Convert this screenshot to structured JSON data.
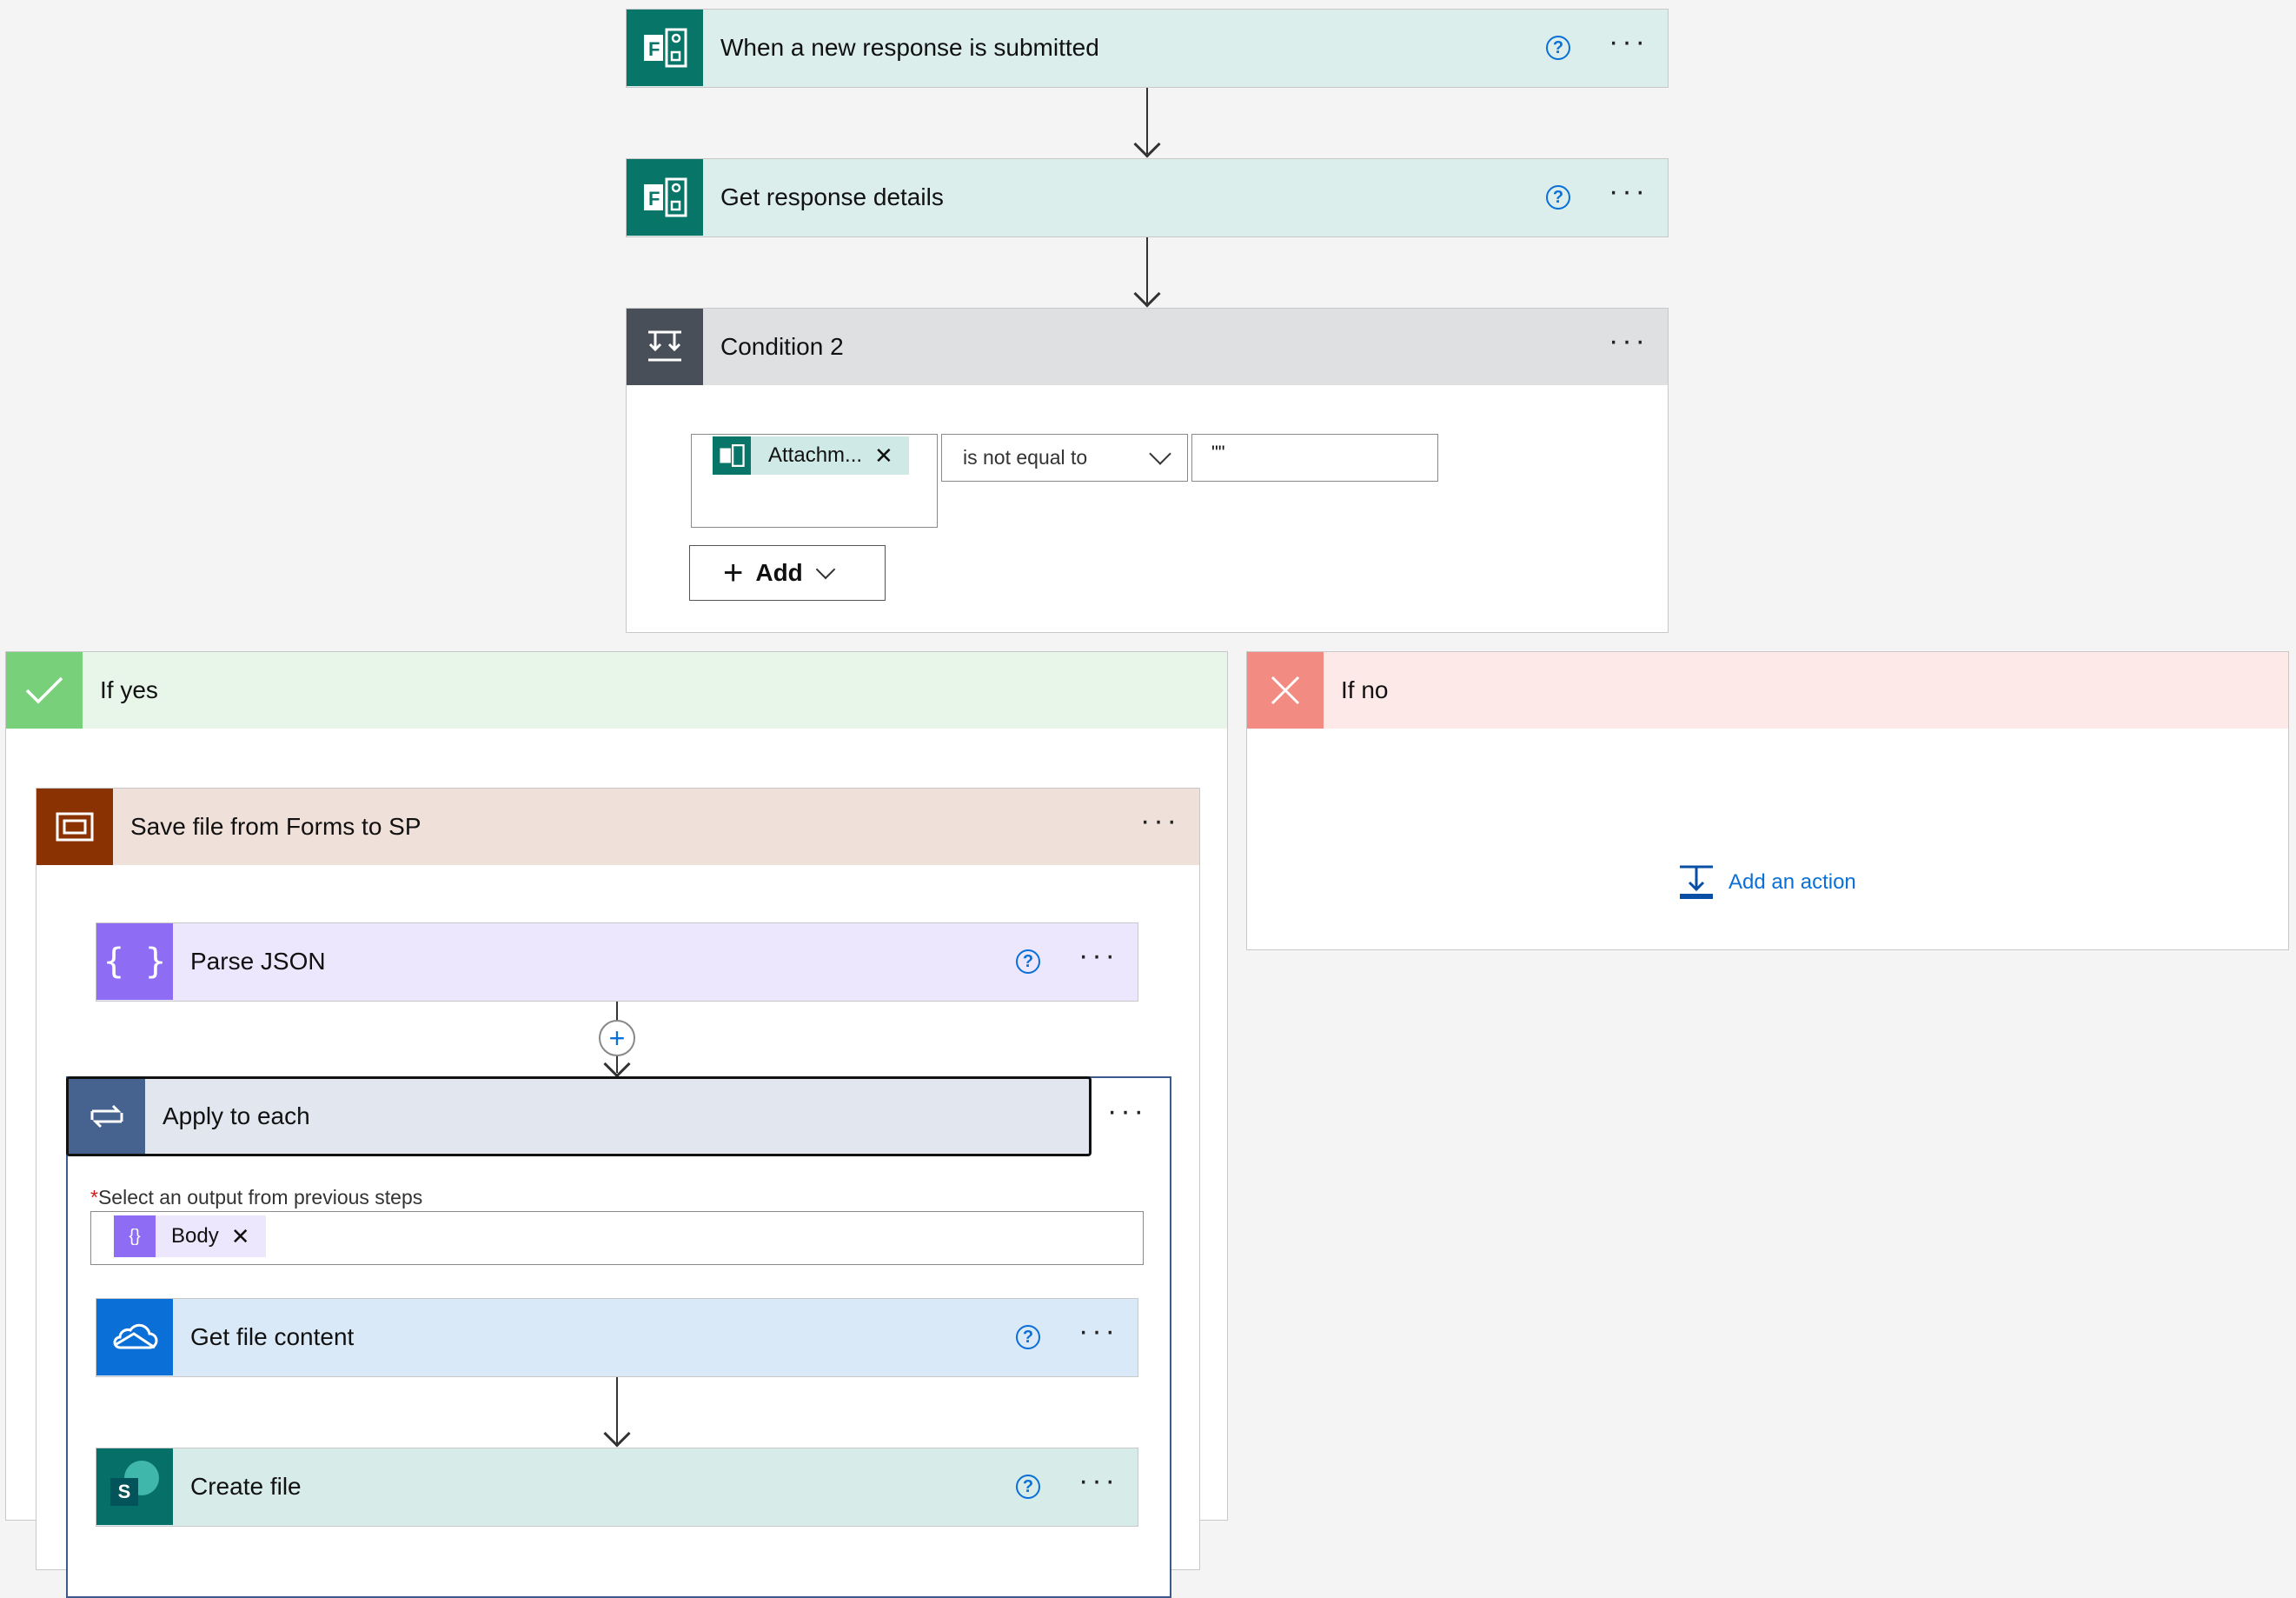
{
  "trigger": {
    "title": "When a new response is submitted",
    "icon": "forms-icon",
    "color": "#077568"
  },
  "get_details": {
    "title": "Get response details",
    "icon": "forms-icon",
    "color": "#077568"
  },
  "condition": {
    "title": "Condition 2",
    "token_label": "Attachm...",
    "operator": "is not equal to",
    "value": "\"\"",
    "add_label": "Add"
  },
  "if_yes": {
    "label": "If yes",
    "color": "#78d17a"
  },
  "if_no": {
    "label": "If no",
    "color": "#f28b82",
    "add_action": "Add an action"
  },
  "scope": {
    "title": "Save file from Forms to SP",
    "color": "#8b3203"
  },
  "parse_json": {
    "title": "Parse JSON",
    "color": "#8e6cf4"
  },
  "apply_each": {
    "title": "Apply to each",
    "field_label": "Select an output from previous steps",
    "required_mark": "*",
    "token_label": "Body",
    "color": "#46628e"
  },
  "get_file": {
    "title": "Get file content",
    "color": "#0a6fd6"
  },
  "create_file": {
    "title": "Create file",
    "color": "#067068",
    "badge": "S"
  },
  "common": {
    "help": "?",
    "more": "···"
  }
}
